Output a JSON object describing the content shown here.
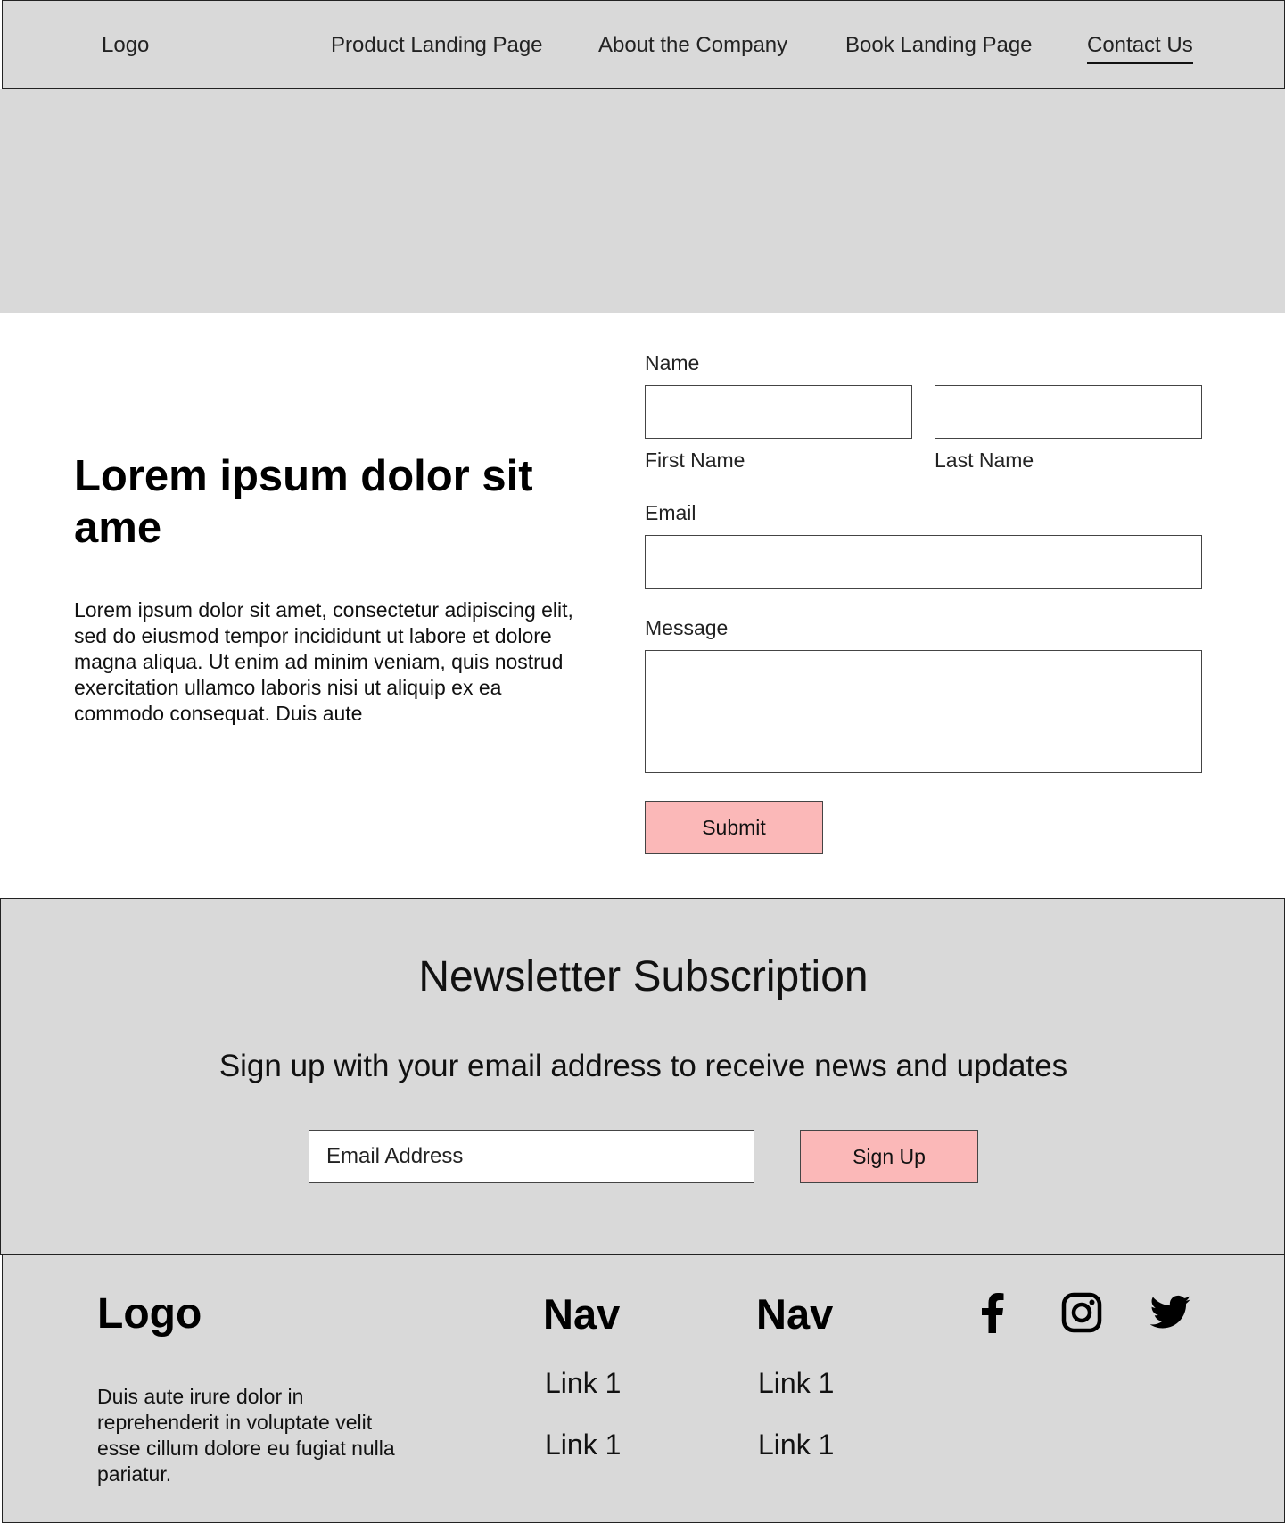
{
  "header": {
    "logo": "Logo",
    "nav": [
      {
        "label": "Product Landing Page"
      },
      {
        "label": "About the Company"
      },
      {
        "label": "Book Landing Page"
      },
      {
        "label": "Contact Us",
        "active": true
      }
    ]
  },
  "contact": {
    "heading": "Lorem ipsum dolor sit ame",
    "body": "Lorem ipsum dolor sit amet, consectetur adipiscing elit, sed do eiusmod tempor incididunt ut labore et dolore magna aliqua. Ut enim ad minim veniam, quis nostrud exercitation ullamco laboris nisi ut aliquip ex ea commodo consequat. Duis aute",
    "form": {
      "name_label": "Name",
      "first_name_label": "First Name",
      "last_name_label": "Last Name",
      "email_label": "Email",
      "message_label": "Message",
      "first_name_value": "",
      "last_name_value": "",
      "email_value": "",
      "message_value": "",
      "submit_label": "Submit"
    }
  },
  "newsletter": {
    "title": "Newsletter Subscription",
    "subtitle": "Sign up with your email address to receive news and updates",
    "email_placeholder": "Email Address",
    "signup_label": "Sign Up"
  },
  "footer": {
    "logo": "Logo",
    "text": "Duis aute irure dolor in reprehenderit in voluptate velit esse cillum dolore eu fugiat nulla pariatur.",
    "nav_columns": [
      {
        "title": "Nav",
        "links": [
          "Link 1",
          "Link 1"
        ]
      },
      {
        "title": "Nav",
        "links": [
          "Link 1",
          "Link 1"
        ]
      }
    ],
    "social": [
      "facebook-icon",
      "instagram-icon",
      "twitter-icon"
    ]
  },
  "colors": {
    "panel_gray": "#d9d9d9",
    "button_pink": "#fbb8b8",
    "border": "#444444"
  }
}
